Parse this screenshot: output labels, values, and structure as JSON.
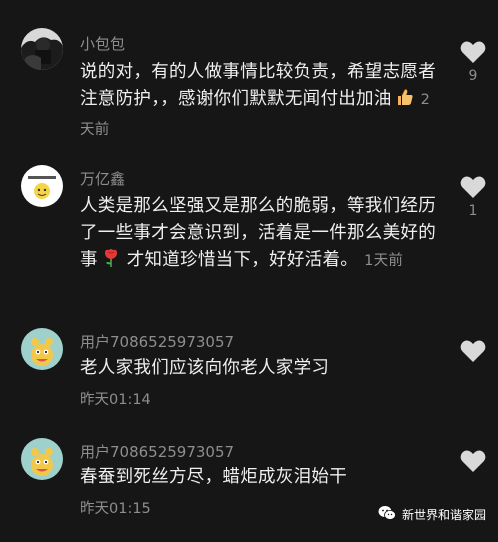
{
  "comments": [
    {
      "username": "小包包",
      "text": "说的对，有的人做事情比较负责，希望志愿者注意防护，，感谢你们默默无闻付出加油",
      "emoji": "thumbs-up",
      "time": "2天前",
      "likes": "9",
      "avatar": "photo-avatar"
    },
    {
      "username": "万亿鑫",
      "text": "人类是那么坚强又是那么的脆弱，等我们经历了一些事才会意识到，活着是一件那么美好的事",
      "emoji": "rose",
      "text_after": "才知道珍惜当下，好好活着。",
      "time": "1天前",
      "likes": "1",
      "avatar": "sticker-avatar"
    },
    {
      "username": "用户7086525973057",
      "text": "老人家我们应该向你老人家学习",
      "time": "昨天01:14",
      "likes": "",
      "avatar": "monster-avatar"
    },
    {
      "username": "用户7086525973057",
      "text": "春蚕到死丝方尽，蜡炬成灰泪始干",
      "time": "昨天01:15",
      "likes": "",
      "avatar": "monster-avatar"
    }
  ],
  "watermark": {
    "text": "新世界和谐家园",
    "icon": "wechat-icon"
  },
  "colors": {
    "background": "#161616",
    "text": "#efefef",
    "muted": "#8e8e8e",
    "heart": "#d9d9d9",
    "avatar_teal": "#9fd1cc"
  }
}
